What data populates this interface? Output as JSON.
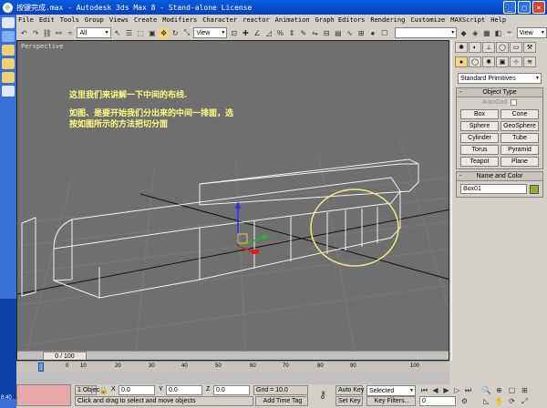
{
  "window": {
    "title": "按键完成.max - Autodesk 3ds Max 8 - Stand-alone License",
    "minimize": "_",
    "maximize": "□",
    "close": "×"
  },
  "menu": [
    "File",
    "Edit",
    "Tools",
    "Group",
    "Views",
    "Create",
    "Modifiers",
    "Character",
    "reactor",
    "Animation",
    "Graph Editors",
    "Rendering",
    "Customize",
    "MAXScript",
    "Help"
  ],
  "toolbar": {
    "selection_filter": "All",
    "ref_coord": "View",
    "view_right": "View"
  },
  "viewport": {
    "label": "Perspective",
    "note_line1": "这里我们来讲解一下中间的布线.",
    "note_line2": "如图、是要开始我们分出来的中间一排面，选",
    "note_line3": "按如图所示的方法把切分面",
    "frame_counter": "0 / 100"
  },
  "timeline": {
    "ticks": [
      "0",
      "10",
      "20",
      "30",
      "40",
      "50",
      "60",
      "70",
      "80",
      "90",
      "100"
    ]
  },
  "command_panel": {
    "dropdown": "Standard Primitives",
    "object_type_title": "Object Type",
    "autogrid_label": "AutoGrid",
    "buttons": [
      "Box",
      "Cone",
      "Sphere",
      "GeoSphere",
      "Cylinder",
      "Tube",
      "Torus",
      "Pyramid",
      "Teapot",
      "Plane"
    ],
    "name_color_title": "Name and Color",
    "object_name": "Box01",
    "object_color": "#8fb020"
  },
  "status": {
    "objects": "1 Objec",
    "x_label": "X",
    "x_value": "0.0",
    "y_label": "Y",
    "y_value": "0.0",
    "z_label": "Z",
    "z_value": "0.0",
    "grid": "Grid = 10.0",
    "prompt": "Click and drag to select and move objects",
    "add_time_tag": "Add Time Tag",
    "auto_key": "Auto Key",
    "set_key": "Set Key",
    "selected": "Selected",
    "key_filters": "Key Filters...",
    "frame": "0",
    "clock": "8:40"
  },
  "colors": {
    "viewport_bg": "#6f6f6f",
    "note_text": "#ffff80",
    "highlight_circle": "#f4ea7a"
  }
}
